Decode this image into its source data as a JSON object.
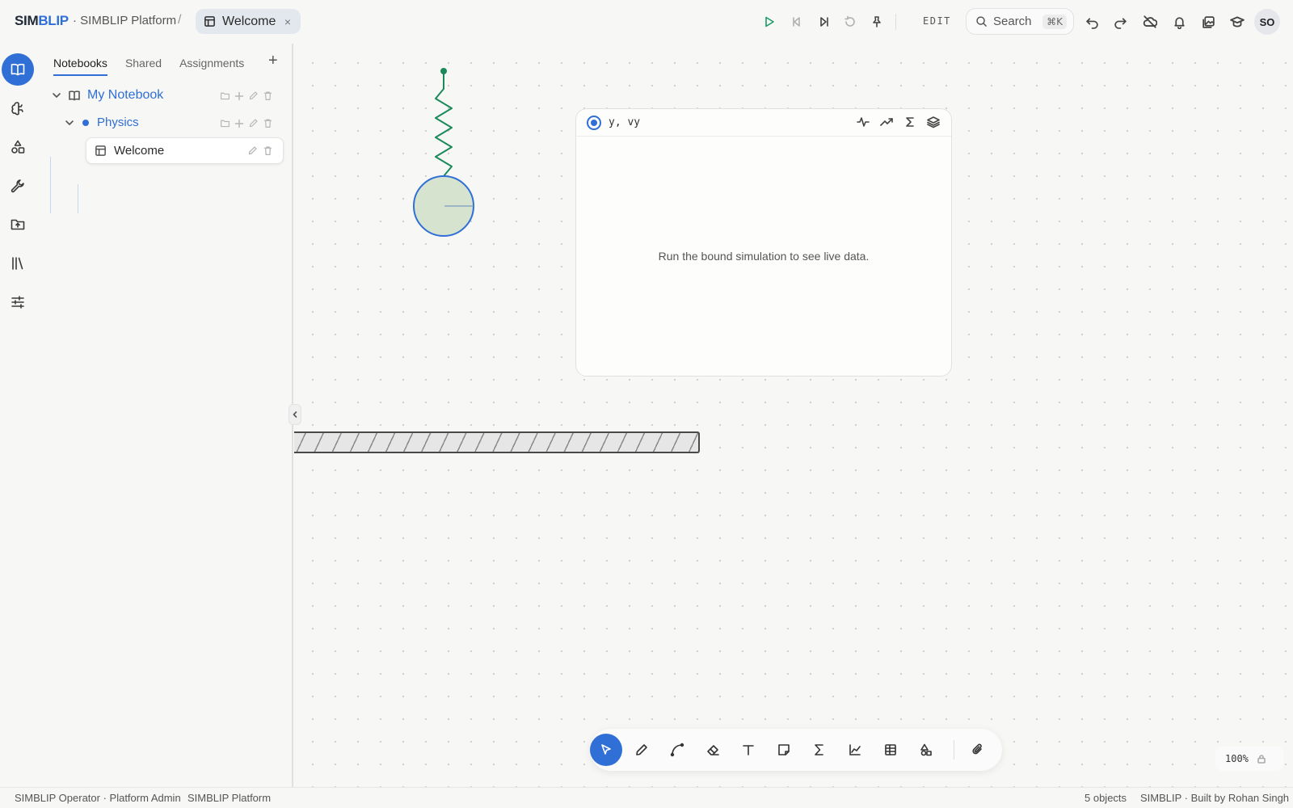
{
  "header": {
    "logo": {
      "part1": "SIM",
      "part2": "BLIP"
    },
    "app_name": "· SIMBLIP Platform",
    "separator": "/",
    "tab": {
      "label": "Welcome",
      "close": "×"
    },
    "mode_label": "EDIT",
    "search": {
      "label": "Search",
      "shortcut": "⌘K"
    },
    "avatar_initials": "SO"
  },
  "sidebar": {
    "tabs": [
      "Notebooks",
      "Shared",
      "Assignments"
    ],
    "active_tab": "Notebooks",
    "add": "+",
    "tree": {
      "notebook": "My Notebook",
      "folder": "Physics",
      "page": "Welcome"
    }
  },
  "plot": {
    "title": "y, vy",
    "empty_message": "Run the bound simulation to see live data."
  },
  "zoom": {
    "level": "100%"
  },
  "status": {
    "user": "SIMBLIP Operator · Platform Admin",
    "platform": "SIMBLIP Platform",
    "object_count": "5 objects",
    "credit": "SIMBLIP · Built by Rohan Singh"
  },
  "colors": {
    "accent": "#2f6fd6",
    "spring": "#1a8a5a",
    "mass_fill": "#d5e3cf",
    "run": "#1a9a6a"
  }
}
